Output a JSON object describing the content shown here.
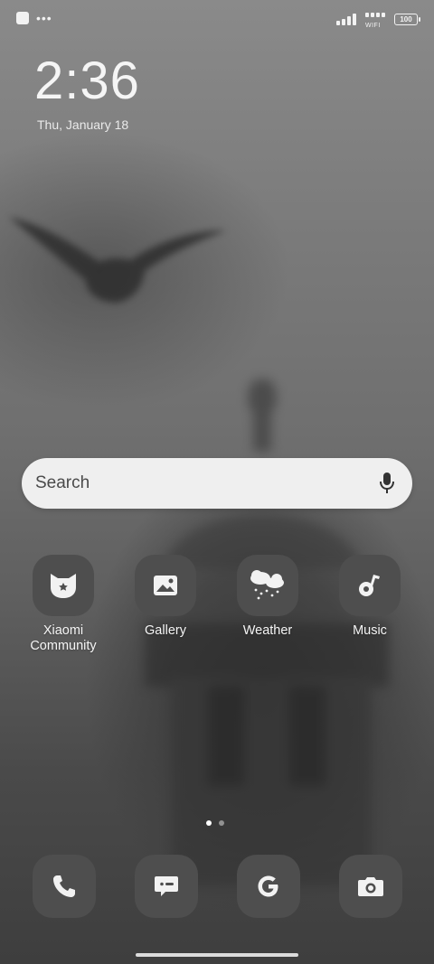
{
  "status_bar": {
    "wifi_label": "WIFI",
    "battery_level": "100"
  },
  "lockscreen": {
    "time": "2:36",
    "date": "Thu, January 18"
  },
  "search": {
    "placeholder": "Search",
    "icon": "microphone-icon"
  },
  "apps": [
    {
      "label": "Xiaomi Community",
      "icon": "xiaomi-community-icon"
    },
    {
      "label": "Gallery",
      "icon": "gallery-icon"
    },
    {
      "label": "Weather",
      "icon": "weather-icon"
    },
    {
      "label": "Music",
      "icon": "music-icon"
    }
  ],
  "pager": {
    "pages": 2,
    "current": 1
  },
  "dock": [
    {
      "icon": "phone-icon"
    },
    {
      "icon": "messages-icon"
    },
    {
      "icon": "google-icon"
    },
    {
      "icon": "camera-icon"
    }
  ],
  "colors": {
    "icon_bg": "#4e4e4e",
    "search_bg": "#efefef",
    "text": "#ffffff"
  }
}
